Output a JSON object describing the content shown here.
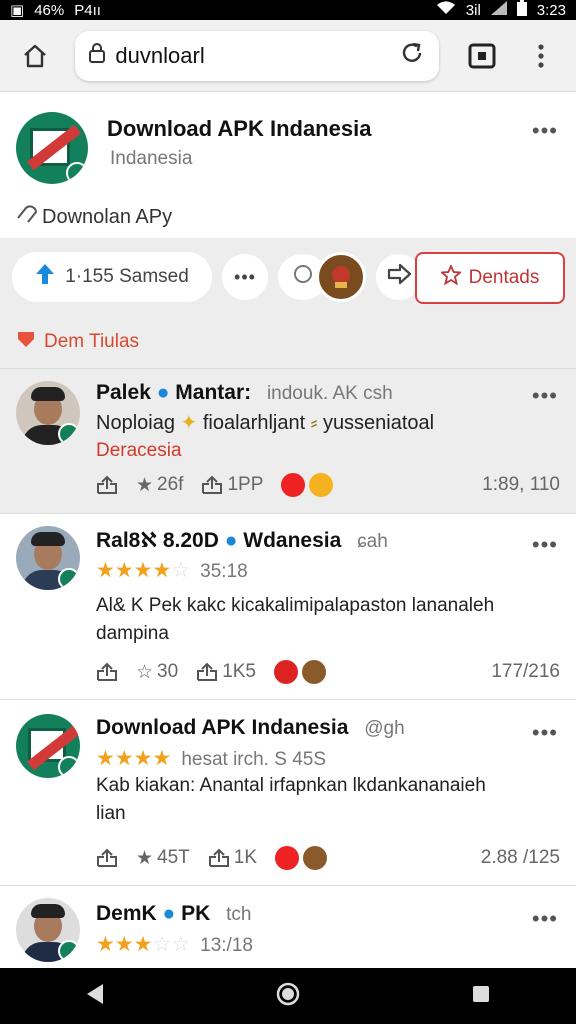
{
  "status": {
    "battery_pct": "46%",
    "carrier": "P4ıı",
    "time": "3:23",
    "signal": "3il"
  },
  "browser": {
    "url": "duvnloarl"
  },
  "app": {
    "title": "Download APK Indanesia",
    "subtitle": "Indanesia",
    "note": "Downolan APy"
  },
  "actions": {
    "count_label": "1·155 Samsed",
    "red_button": "Dentads"
  },
  "section": {
    "title": "Dem Tiulas"
  },
  "reviews": [
    {
      "name": "Palek",
      "name2": "Mantar:",
      "meta": "indouk. AK  csh",
      "text1": "Noploiag",
      "text1b": "fioalarhljant",
      "text1c": "yusseniatoal",
      "text2": "Deracesia",
      "stars": "",
      "when": "",
      "like_count": "26f",
      "share_count": "1PP",
      "date": "1:89, 110"
    },
    {
      "name": "Ral8ℵ 8.20D",
      "name2": "Wdanesia",
      "meta": "ɕah",
      "stars": "★★★★",
      "stars_off": "☆",
      "when": "35:18",
      "text1": "Al& K Pek kakc kicakalimipalapaston lananaleh",
      "text2": "dampina",
      "like_count": "30",
      "share_count": "1K5",
      "date": "177/216"
    },
    {
      "name": "Download APK Indanesia",
      "meta": "@gh",
      "stars": "★★★★",
      "stars_off": "",
      "when": "hesat irch. S 45S",
      "text1": "Kab kiakan: Anantal irfapnkan lkdankananaieh",
      "text2": "lian",
      "like_count": "45T",
      "share_count": "1K",
      "date": "2.88 /125"
    },
    {
      "name": "DemK",
      "name2": "PK",
      "meta": "tch",
      "stars": "★★★",
      "stars_off": "☆☆",
      "when": "13:/18"
    }
  ],
  "colors": {
    "accent_red": "#d94040",
    "star": "#f2a11f",
    "logo_green": "#14805b",
    "link_blue": "#1a8ad8"
  },
  "icons": [
    "home-icon",
    "lock-icon",
    "refresh-icon",
    "tab-switcher-icon",
    "menu-dots-icon",
    "upvote-arrow-icon",
    "share-arrow-icon",
    "star-outline-icon",
    "like-icon",
    "back-icon",
    "home-circle-icon",
    "recents-icon"
  ]
}
